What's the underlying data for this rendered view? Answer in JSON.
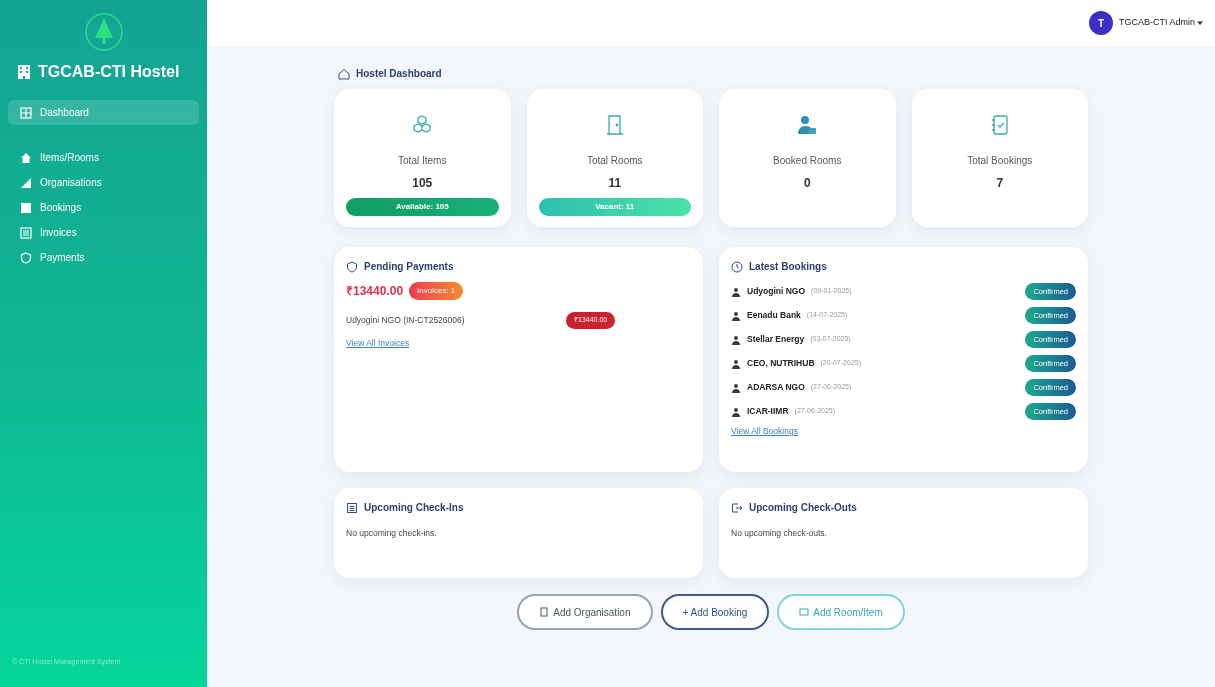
{
  "sidebar": {
    "brand": "TGCAB-CTI Hostel",
    "items": [
      {
        "label": "Dashboard",
        "selected": true
      },
      {
        "label": "Items/Rooms",
        "selected": false
      },
      {
        "label": "Organisations",
        "selected": false
      },
      {
        "label": "Bookings",
        "selected": false
      },
      {
        "label": "Invoices",
        "selected": false
      },
      {
        "label": "Payments",
        "selected": false
      }
    ],
    "footer": "© CTI Hostel Management System"
  },
  "header": {
    "user_initial": "T",
    "user_name": "TGCAB-CTI Admin"
  },
  "page_title": "Hostel Dashboard",
  "stats": [
    {
      "label": "Total Items",
      "value": "105",
      "badge": "Available: 105"
    },
    {
      "label": "Total Rooms",
      "value": "11",
      "badge": "Vacant: 11"
    },
    {
      "label": "Booked Rooms",
      "value": "0"
    },
    {
      "label": "Total Bookings",
      "value": "7"
    }
  ],
  "pending_payments": {
    "title": "Pending Payments",
    "total": "₹13440.00",
    "invoice_count": "Invoices: 1",
    "invoices": [
      {
        "name": "Udyogini NGO (IN-CT2526006)",
        "amount": "₹13440.00"
      }
    ],
    "link": "View All Invoices"
  },
  "latest_bookings": {
    "title": "Latest Bookings",
    "rows": [
      {
        "name": "Udyogini NGO",
        "date": "(09-01-2025)",
        "status": "Confirmed"
      },
      {
        "name": "Eenadu Bank",
        "date": "(14-07-2025)",
        "status": "Confirmed"
      },
      {
        "name": "Stellar Energy",
        "date": "(03-07-2025)",
        "status": "Confirmed"
      },
      {
        "name": "CEO, NUTRIHUB",
        "date": "(20-07-2025)",
        "status": "Confirmed"
      },
      {
        "name": "ADARSA NGO",
        "date": "(27-06-2025)",
        "status": "Confirmed"
      },
      {
        "name": "ICAR-IIMR",
        "date": "(27-06-2025)",
        "status": "Confirmed"
      }
    ],
    "link": "View All Bookings"
  },
  "checkins": {
    "title": "Upcoming Check-Ins",
    "empty": "No upcoming check-ins."
  },
  "checkouts": {
    "title": "Upcoming Check-Outs",
    "empty": "No upcoming check-outs."
  },
  "actions": [
    {
      "label": "Add Organisation",
      "kind": "gray"
    },
    {
      "label": "+ Add Booking",
      "kind": "blue"
    },
    {
      "label": "Add Room/Item",
      "kind": "cyan"
    }
  ]
}
